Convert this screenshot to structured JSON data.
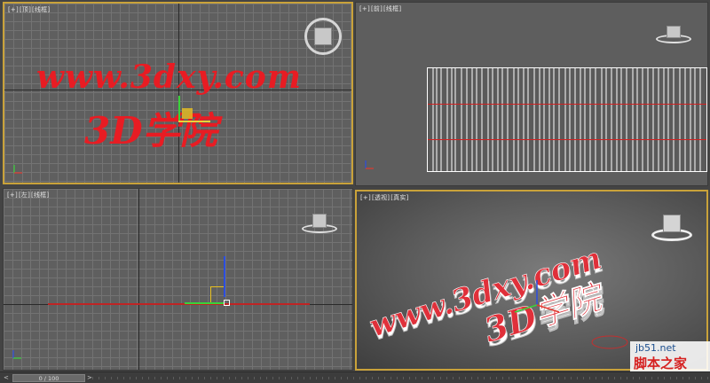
{
  "viewports": {
    "top": {
      "labels": [
        "[+]",
        "[顶]",
        "[线框]"
      ]
    },
    "front": {
      "labels": [
        "[+]",
        "[前]",
        "[线框]"
      ]
    },
    "left": {
      "labels": [
        "[+]",
        "[左]",
        "[线框]"
      ]
    },
    "perspective": {
      "labels": [
        "[+]",
        "[透视]",
        "[真实]"
      ]
    }
  },
  "scene_text": {
    "url": "www.3dxy.com",
    "cn": "3D学院"
  },
  "timeline": {
    "frame": "0 / 100",
    "prev": "<",
    "next": ">"
  },
  "watermark": {
    "url": "jb51.net",
    "name": "脚本之家"
  },
  "colors": {
    "active_border": "#c9a23a",
    "text_red": "#e81c23",
    "axis_x": "#e03a30",
    "axis_y": "#3ad23a",
    "axis_z": "#2b4ee0"
  }
}
